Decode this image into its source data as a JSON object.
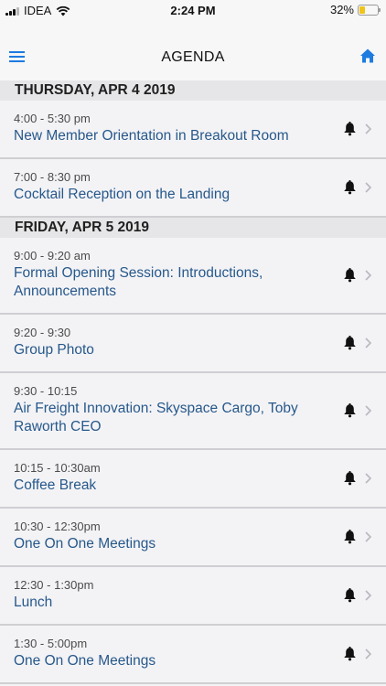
{
  "status": {
    "carrier": "IDEA",
    "time": "2:24 PM",
    "battery_pct": "32%",
    "battery_level": 0.32,
    "icons": [
      "signal-icon",
      "wifi-icon",
      "battery-icon"
    ]
  },
  "nav": {
    "title": "AGENDA",
    "left_icon": "menu-icon",
    "right_icon": "home-icon",
    "accent": "#1e7be0"
  },
  "colors": {
    "title_link": "#27588a",
    "header_bg": "#e6e6e8"
  },
  "days": [
    {
      "label": "THURSDAY, APR 4 2019",
      "events": [
        {
          "time": "4:00 - 5:30 pm",
          "title": "New Member Orientation in Breakout Room"
        },
        {
          "time": "7:00 - 8:30 pm",
          "title": "Cocktail Reception on the Landing"
        }
      ]
    },
    {
      "label": "FRIDAY, APR 5 2019",
      "events": [
        {
          "time": "9:00 - 9:20 am",
          "title": "Formal Opening Session: Introductions,",
          "title2": "Announcements"
        },
        {
          "time": "9:20 - 9:30",
          "title": "Group Photo"
        },
        {
          "time": "9:30 - 10:15",
          "title": "Air Freight Innovation: Skyspace Cargo, Toby",
          "title2": "Raworth CEO"
        },
        {
          "time": "10:15 - 10:30am",
          "title": "Coffee Break"
        },
        {
          "time": "10:30 - 12:30pm",
          "title": "One On One Meetings"
        },
        {
          "time": "12:30 - 1:30pm",
          "title": "Lunch"
        },
        {
          "time": "1:30 - 5:00pm",
          "title": "One On One Meetings"
        }
      ]
    }
  ]
}
